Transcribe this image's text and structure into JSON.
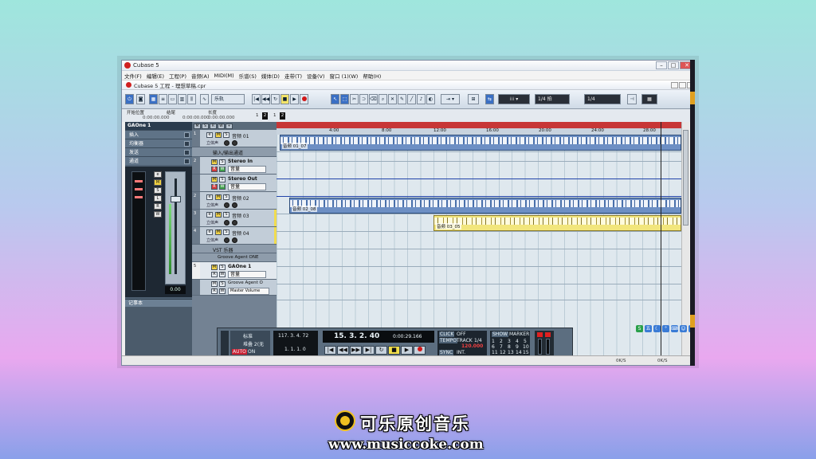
{
  "window": {
    "title": "Cubase 5",
    "project_title": "Cubase 5 工程 - 理想草稿.cpr"
  },
  "menu": [
    "文件(F)",
    "编辑(E)",
    "工程(P)",
    "音频(A)",
    "MIDI(M)",
    "乐谱(S)",
    "媒体(D)",
    "走带(T)",
    "设备(V)",
    "窗口 (1)(W)",
    "帮助(H)"
  ],
  "toolbar": {
    "mode_select": "乐轨",
    "quantize_1": "1/4 拍",
    "quantize_2": "1/4"
  },
  "infoline": {
    "start_label": "开始位置",
    "start_value": "0:00:00.000",
    "end_label": "结尾",
    "end_value": "0:00:00.000",
    "length_label": "长度",
    "length_value": "0:00:00.000",
    "markers": [
      "1",
      "2",
      "1",
      "2"
    ]
  },
  "inspector": {
    "track_name": "GAOne 1",
    "sections": [
      "插入",
      "均衡器",
      "发送",
      "通道"
    ],
    "channel_buttons": [
      "e",
      "M",
      "S",
      "L",
      "R",
      "W"
    ],
    "channel_value": "0.00",
    "notepad": "记事本"
  },
  "tracklist": {
    "tracks": [
      {
        "num": "1",
        "name": "音频 01",
        "sub": "立体声"
      },
      {
        "num": "",
        "name": "输入/输出通道",
        "sub": ""
      },
      {
        "num": "2",
        "name": "Stereo In",
        "sub": "",
        "box": "音量"
      },
      {
        "num": "",
        "name": "Stereo Out",
        "sub": "",
        "box": "音量"
      },
      {
        "num": "2",
        "name": "音频 02",
        "sub": "立体声"
      },
      {
        "num": "3",
        "name": "音频 03",
        "sub": "立体声"
      },
      {
        "num": "4",
        "name": "音频 04",
        "sub": "立体声"
      },
      {
        "num": "",
        "name": "VST 乐器",
        "sub": ""
      },
      {
        "num": "",
        "name": "Groove Agent ONE",
        "sub": ""
      },
      {
        "num": "5",
        "name": "GAOne 1",
        "sub": "",
        "box": "音量"
      },
      {
        "num": "",
        "name": "Groove Agent O",
        "sub": "",
        "box": "Master Volume"
      }
    ]
  },
  "ruler": {
    "ticks": [
      "4:00",
      "8:00",
      "12:00",
      "16:00",
      "20:00",
      "24:00",
      "28:00"
    ]
  },
  "events": [
    {
      "label": "音频 01_07"
    },
    {
      "label": "音频 02_08"
    },
    {
      "label": "音频 03_05"
    }
  ],
  "transport": {
    "locator_left": "117. 3. 4. 72",
    "locator_right": "1. 1. 1. 0",
    "position": "15. 3. 2. 40",
    "time": "0:00:29.166",
    "click_label": "CLICK",
    "click_state": "OFF",
    "tempo_label": "TEMPO",
    "tempo_mode": "TRACK",
    "signature": "1/4",
    "tempo_value": "120.000",
    "sync_label": "SYNC",
    "sync_state": "INT.",
    "show_label": "SHOW",
    "marker_label": "MARKER",
    "marker_nums": [
      "1",
      "2",
      "3",
      "4",
      "5",
      "6",
      "7",
      "8",
      "9",
      "10",
      "11",
      "12",
      "13",
      "14",
      "15"
    ],
    "auto_label": "AUTO",
    "auto_state": "ON",
    "left_label_1": "标准",
    "left_label_2": "堆叠 2(无"
  },
  "footer": {
    "status_1": "0K/S",
    "status_2": "0K/S"
  },
  "brand": {
    "name": "可乐原创音乐",
    "url": "www.musiccoke.com"
  }
}
